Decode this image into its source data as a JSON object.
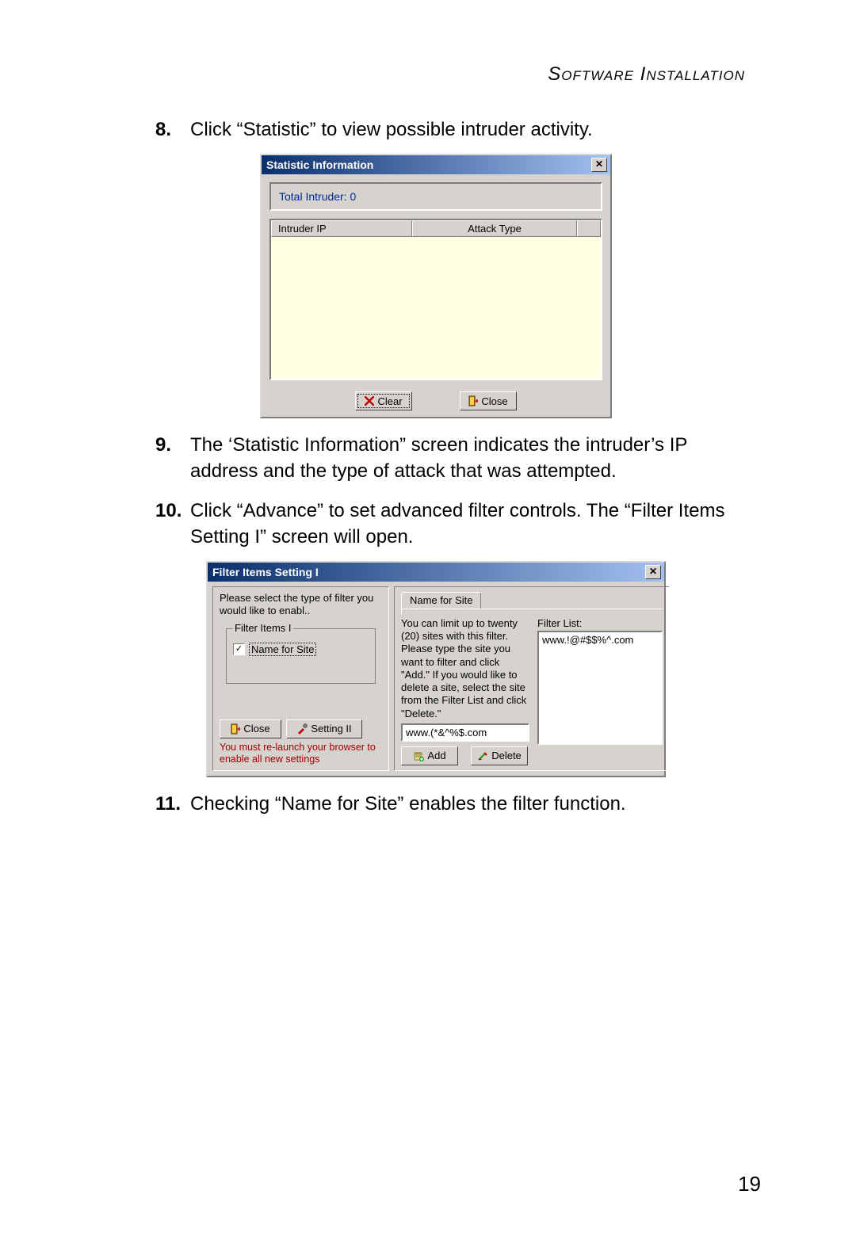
{
  "header": {
    "section_title": "Software Installation"
  },
  "steps": {
    "s8": {
      "num": "8.",
      "text": "Click “Statistic” to view possible intruder activity."
    },
    "s9": {
      "num": "9.",
      "text": "The ‘Statistic Information” screen indicates the intruder’s IP address and the type of attack that was attempted."
    },
    "s10": {
      "num": "10.",
      "text": "Click “Advance” to set advanced filter controls. The “Filter Items Setting I” screen will open."
    },
    "s11": {
      "num": "11.",
      "text": "Checking “Name for Site” enables the filter function."
    }
  },
  "page_number": "19",
  "dialog1": {
    "title": "Statistic Information",
    "total_intruder_label": "Total Intruder:  0",
    "col_intruder_ip": "Intruder IP",
    "col_attack_type": "Attack Type",
    "btn_clear": "Clear",
    "btn_close": "Close"
  },
  "dialog2": {
    "title": "Filter Items  Setting I",
    "left_text": "Please select the type of filter you would like to enabl..",
    "groupbox_label": "Filter Items I",
    "checkbox_label": "Name for Site",
    "btn_close": "Close",
    "btn_setting2": "Setting II",
    "warn": "You must re-launch your browser to enable all new settings",
    "tab_label": "Name for  Site",
    "desc": "You can limit up to twenty (20) sites with this filter. Please type the site you want to filter and click \"Add.\"  If you would like to delete a site, select the site from the Filter List and click \"Delete.\"",
    "input_value": "www.(*&^%$.com",
    "filter_list_label": "Filter List:",
    "filter_list_item": "www.!@#$$%^.com",
    "btn_add": "Add",
    "btn_delete": "Delete"
  }
}
